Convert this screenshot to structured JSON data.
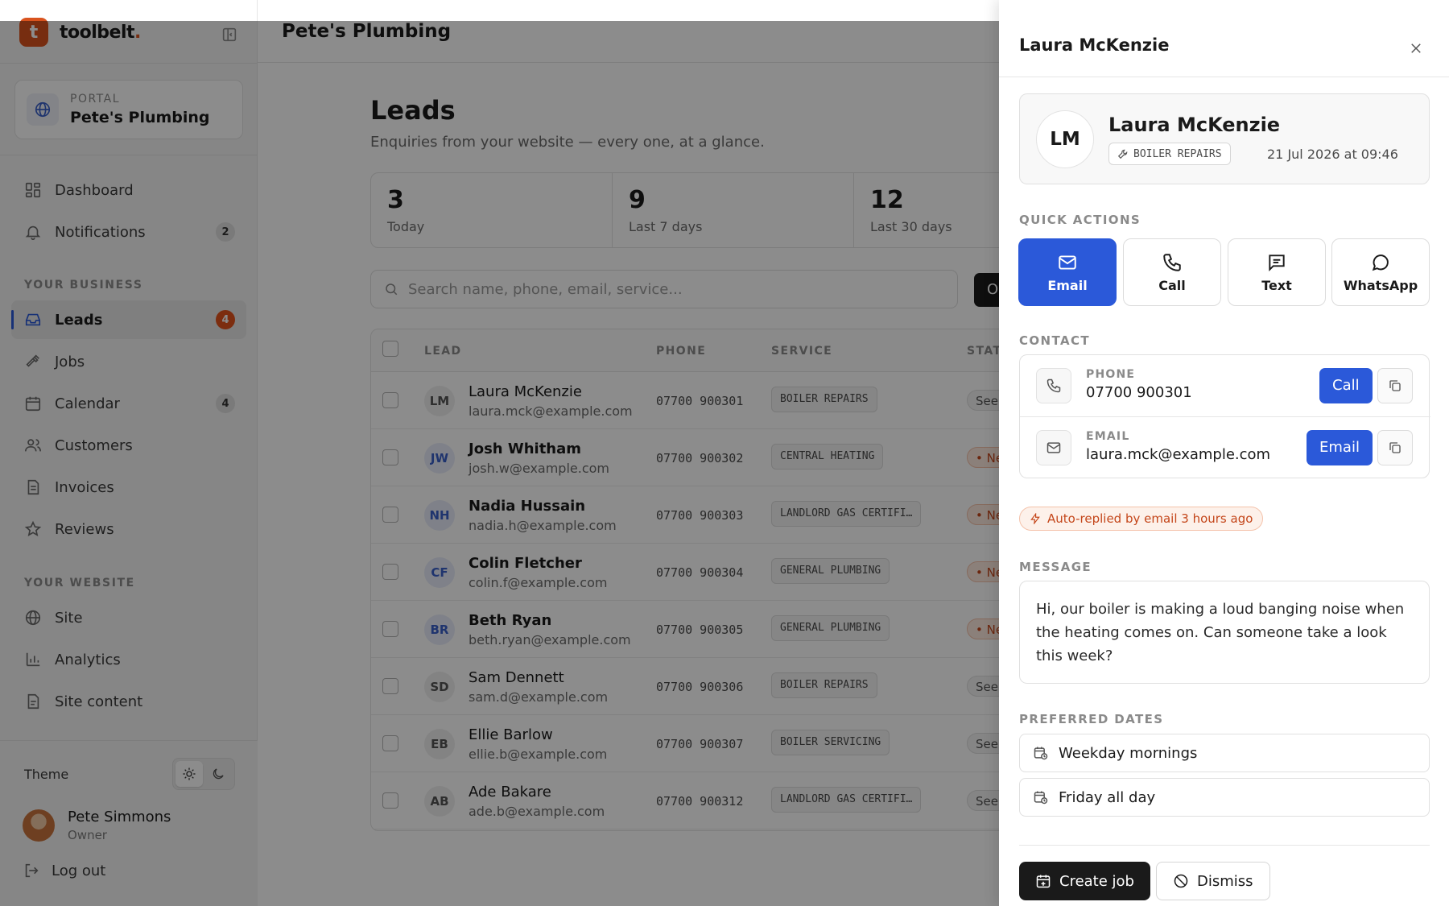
{
  "brand": {
    "logo_letter": "t",
    "name": "toolbelt",
    "name_dot": "."
  },
  "portal": {
    "label": "PORTAL",
    "name": "Pete's Plumbing"
  },
  "sidebar": {
    "items": [
      {
        "label": "Dashboard",
        "icon": "dashboard-icon"
      },
      {
        "label": "Notifications",
        "badge": "2",
        "icon": "bell-icon"
      },
      {
        "label": "Leads",
        "badge": "4",
        "icon": "inbox-icon"
      },
      {
        "label": "Jobs",
        "icon": "hammer-icon"
      },
      {
        "label": "Calendar",
        "badge": "4",
        "icon": "calendar-icon"
      },
      {
        "label": "Customers",
        "icon": "users-icon"
      },
      {
        "label": "Invoices",
        "icon": "document-icon"
      },
      {
        "label": "Reviews",
        "icon": "star-icon"
      },
      {
        "label": "Site",
        "icon": "globe-icon"
      },
      {
        "label": "Analytics",
        "icon": "bar-chart-icon"
      },
      {
        "label": "Site content",
        "icon": "file-icon"
      }
    ],
    "sections": {
      "business": "YOUR BUSINESS",
      "website": "YOUR WEBSITE"
    },
    "theme_label": "Theme",
    "user": {
      "name": "Pete Simmons",
      "role": "Owner"
    },
    "logout_label": "Log out"
  },
  "header": {
    "title": "Pete's Plumbing"
  },
  "page": {
    "title": "Leads",
    "subtitle": "Enquiries from your website — every one, at a glance."
  },
  "stats": [
    {
      "value": "3",
      "label": "Today"
    },
    {
      "value": "9",
      "label": "Last 7 days"
    },
    {
      "value": "12",
      "label": "Last 30 days"
    }
  ],
  "search": {
    "placeholder": "Search name, phone, email, service..."
  },
  "filter_button_partial": "O",
  "table": {
    "columns": {
      "lead": "LEAD",
      "phone": "PHONE",
      "service": "SERVICE",
      "status": "STATU"
    },
    "rows": [
      {
        "initials": "LM",
        "name": "Laura McKenzie",
        "email": "laura.mck@example.com",
        "phone": "07700 900301",
        "service": "BOILER REPAIRS",
        "status": "Seen",
        "is_new": false
      },
      {
        "initials": "JW",
        "name": "Josh Whitham",
        "email": "josh.w@example.com",
        "phone": "07700 900302",
        "service": "CENTRAL HEATING",
        "status": "• Ne",
        "is_new": true
      },
      {
        "initials": "NH",
        "name": "Nadia Hussain",
        "email": "nadia.h@example.com",
        "phone": "07700 900303",
        "service": "LANDLORD GAS CERTIFI…",
        "status": "• Ne",
        "is_new": true
      },
      {
        "initials": "CF",
        "name": "Colin Fletcher",
        "email": "colin.f@example.com",
        "phone": "07700 900304",
        "service": "GENERAL PLUMBING",
        "status": "• Ne",
        "is_new": true
      },
      {
        "initials": "BR",
        "name": "Beth Ryan",
        "email": "beth.ryan@example.com",
        "phone": "07700 900305",
        "service": "GENERAL PLUMBING",
        "status": "• Ne",
        "is_new": true
      },
      {
        "initials": "SD",
        "name": "Sam Dennett",
        "email": "sam.d@example.com",
        "phone": "07700 900306",
        "service": "BOILER REPAIRS",
        "status": "Seen",
        "is_new": false
      },
      {
        "initials": "EB",
        "name": "Ellie Barlow",
        "email": "ellie.b@example.com",
        "phone": "07700 900307",
        "service": "BOILER SERVICING",
        "status": "Seen",
        "is_new": false
      },
      {
        "initials": "AB",
        "name": "Ade Bakare",
        "email": "ade.b@example.com",
        "phone": "07700 900312",
        "service": "LANDLORD GAS CERTIFI…",
        "status": "Seen",
        "is_new": false
      }
    ]
  },
  "drawer": {
    "title": "Laura McKenzie",
    "profile": {
      "initials": "LM",
      "name": "Laura McKenzie",
      "service_tag": "BOILER REPAIRS",
      "date": "21 Jul 2026 at 09:46"
    },
    "quick_actions_label": "QUICK ACTIONS",
    "quick_actions": [
      {
        "label": "Email",
        "icon": "mail-icon"
      },
      {
        "label": "Call",
        "icon": "phone-icon"
      },
      {
        "label": "Text",
        "icon": "message-square-icon"
      },
      {
        "label": "WhatsApp",
        "icon": "message-circle-icon"
      }
    ],
    "contact_label": "CONTACT",
    "contact": {
      "phone_label": "PHONE",
      "phone": "07700 900301",
      "phone_action": "Call",
      "email_label": "EMAIL",
      "email": "laura.mck@example.com",
      "email_action": "Email"
    },
    "auto_replied": "Auto-replied by email 3 hours ago",
    "message_label": "MESSAGE",
    "message": "Hi, our boiler is making a loud banging noise when the heating comes on. Can someone take a look this week?",
    "preferred_label": "PREFERRED DATES",
    "preferred_dates": [
      "Weekday mornings",
      "Friday all day"
    ],
    "create_job": "Create job",
    "dismiss": "Dismiss"
  },
  "colors": {
    "accent": "#2b59d9",
    "brand": "#d9531e",
    "new_status": "#c4461a"
  }
}
